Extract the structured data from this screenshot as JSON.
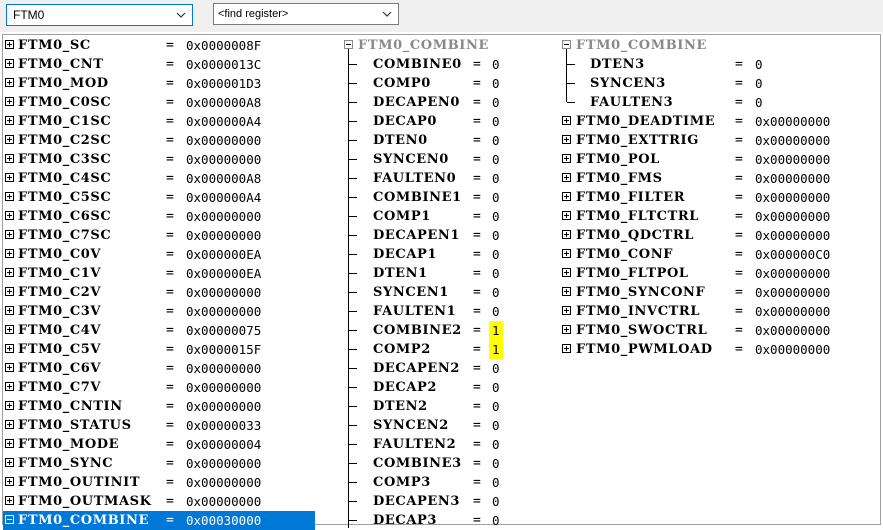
{
  "toolbar": {
    "module_value": "FTM0",
    "find_placeholder": "<find register>"
  },
  "col1": [
    {
      "name": "FTM0_SC",
      "value": "0x0000008F"
    },
    {
      "name": "FTM0_CNT",
      "value": "0x0000013C"
    },
    {
      "name": "FTM0_MOD",
      "value": "0x000001D3"
    },
    {
      "name": "FTM0_C0SC",
      "value": "0x000000A8"
    },
    {
      "name": "FTM0_C1SC",
      "value": "0x000000A4"
    },
    {
      "name": "FTM0_C2SC",
      "value": "0x00000000"
    },
    {
      "name": "FTM0_C3SC",
      "value": "0x00000000"
    },
    {
      "name": "FTM0_C4SC",
      "value": "0x000000A8"
    },
    {
      "name": "FTM0_C5SC",
      "value": "0x000000A4"
    },
    {
      "name": "FTM0_C6SC",
      "value": "0x00000000"
    },
    {
      "name": "FTM0_C7SC",
      "value": "0x00000000"
    },
    {
      "name": "FTM0_C0V",
      "value": "0x000000EA"
    },
    {
      "name": "FTM0_C1V",
      "value": "0x000000EA"
    },
    {
      "name": "FTM0_C2V",
      "value": "0x00000000"
    },
    {
      "name": "FTM0_C3V",
      "value": "0x00000000"
    },
    {
      "name": "FTM0_C4V",
      "value": "0x00000075"
    },
    {
      "name": "FTM0_C5V",
      "value": "0x0000015F"
    },
    {
      "name": "FTM0_C6V",
      "value": "0x00000000"
    },
    {
      "name": "FTM0_C7V",
      "value": "0x00000000"
    },
    {
      "name": "FTM0_CNTIN",
      "value": "0x00000000"
    },
    {
      "name": "FTM0_STATUS",
      "value": "0x00000033"
    },
    {
      "name": "FTM0_MODE",
      "value": "0x00000004"
    },
    {
      "name": "FTM0_SYNC",
      "value": "0x00000000"
    },
    {
      "name": "FTM0_OUTINIT",
      "value": "0x00000000"
    },
    {
      "name": "FTM0_OUTMASK",
      "value": "0x00000000"
    },
    {
      "name": "FTM0_COMBINE",
      "value": "0x00030000",
      "selected": true,
      "expanded": true
    }
  ],
  "col2": {
    "header": "FTM0_COMBINE",
    "fields": [
      {
        "name": "COMBINE0",
        "value": "0"
      },
      {
        "name": "COMP0",
        "value": "0"
      },
      {
        "name": "DECAPEN0",
        "value": "0"
      },
      {
        "name": "DECAP0",
        "value": "0"
      },
      {
        "name": "DTEN0",
        "value": "0"
      },
      {
        "name": "SYNCEN0",
        "value": "0"
      },
      {
        "name": "FAULTEN0",
        "value": "0"
      },
      {
        "name": "COMBINE1",
        "value": "0"
      },
      {
        "name": "COMP1",
        "value": "0"
      },
      {
        "name": "DECAPEN1",
        "value": "0"
      },
      {
        "name": "DECAP1",
        "value": "0"
      },
      {
        "name": "DTEN1",
        "value": "0"
      },
      {
        "name": "SYNCEN1",
        "value": "0"
      },
      {
        "name": "FAULTEN1",
        "value": "0"
      },
      {
        "name": "COMBINE2",
        "value": "1",
        "highlight": true
      },
      {
        "name": "COMP2",
        "value": "1",
        "highlight": true
      },
      {
        "name": "DECAPEN2",
        "value": "0"
      },
      {
        "name": "DECAP2",
        "value": "0"
      },
      {
        "name": "DTEN2",
        "value": "0"
      },
      {
        "name": "SYNCEN2",
        "value": "0"
      },
      {
        "name": "FAULTEN2",
        "value": "0"
      },
      {
        "name": "COMBINE3",
        "value": "0"
      },
      {
        "name": "COMP3",
        "value": "0"
      },
      {
        "name": "DECAPEN3",
        "value": "0"
      },
      {
        "name": "DECAP3",
        "value": "0"
      }
    ]
  },
  "col3": {
    "header": "FTM0_COMBINE",
    "fields": [
      {
        "name": "DTEN3",
        "value": "0"
      },
      {
        "name": "SYNCEN3",
        "value": "0"
      },
      {
        "name": "FAULTEN3",
        "value": "0"
      }
    ],
    "registers": [
      {
        "name": "FTM0_DEADTIME",
        "value": "0x00000000"
      },
      {
        "name": "FTM0_EXTTRIG",
        "value": "0x00000000"
      },
      {
        "name": "FTM0_POL",
        "value": "0x00000000"
      },
      {
        "name": "FTM0_FMS",
        "value": "0x00000000"
      },
      {
        "name": "FTM0_FILTER",
        "value": "0x00000000"
      },
      {
        "name": "FTM0_FLTCTRL",
        "value": "0x00000000"
      },
      {
        "name": "FTM0_QDCTRL",
        "value": "0x00000000"
      },
      {
        "name": "FTM0_CONF",
        "value": "0x000000C0"
      },
      {
        "name": "FTM0_FLTPOL",
        "value": "0x00000000"
      },
      {
        "name": "FTM0_SYNCONF",
        "value": "0x00000000"
      },
      {
        "name": "FTM0_INVCTRL",
        "value": "0x00000000"
      },
      {
        "name": "FTM0_SWOCTRL",
        "value": "0x00000000"
      },
      {
        "name": "FTM0_PWMLOAD",
        "value": "0x00000000"
      }
    ]
  },
  "equals_sign": "="
}
